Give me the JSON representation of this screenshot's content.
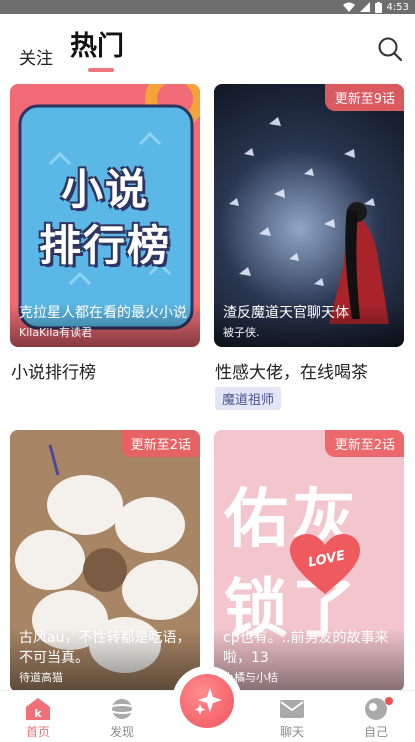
{
  "status_bar": {
    "time": "4:53"
  },
  "header": {
    "tab_follow": "关注",
    "tab_hot": "热门"
  },
  "cards": [
    {
      "cover_text_line1": "小说",
      "cover_text_line2": "排行榜",
      "overlay_title": "克拉星人都在看的最火小说",
      "overlay_author": "KilaKila有读君",
      "caption": "小说排行榜"
    },
    {
      "badge": "更新至9话",
      "overlay_title": "渣反魔道天官聊天体",
      "overlay_author": "被子侠.",
      "caption": "性感大佬，在线喝茶",
      "tag": "魔道祖师"
    },
    {
      "badge": "更新至2话",
      "overlay_title": "古风au，不性转都是吃语，不可当真。",
      "overlay_author": "待道高猫"
    },
    {
      "badge": "更新至2话",
      "cover_text_line1": "佑灰",
      "cover_text_line2": "锁了",
      "cover_love": "LOVE",
      "overlay_title": "cp也有。..前男友的故事来啦，13",
      "overlay_author": "小橘与小桔"
    }
  ],
  "bottom_nav": {
    "home": "首页",
    "discover": "发现",
    "chat": "聊天",
    "me": "自己"
  },
  "colors": {
    "accent": "#f0757c",
    "status_bar": "#6e6e6e"
  }
}
